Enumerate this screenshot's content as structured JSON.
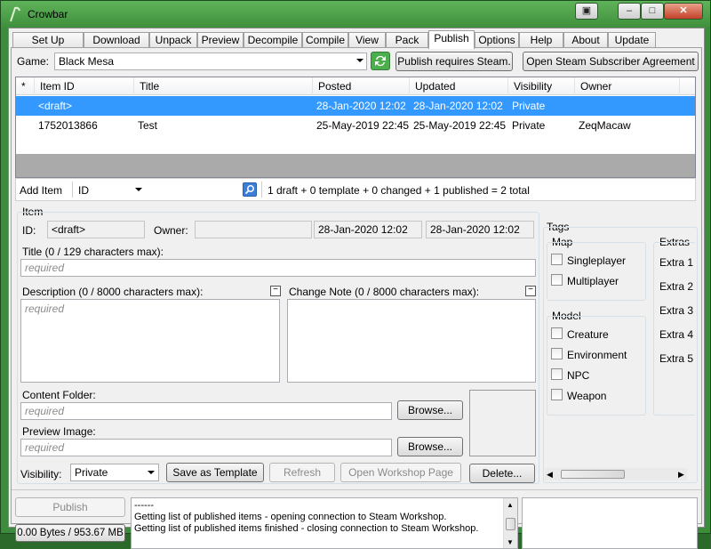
{
  "window": {
    "title": "Crowbar"
  },
  "tabs": [
    {
      "label": "Set Up Games"
    },
    {
      "label": "Download"
    },
    {
      "label": "Unpack"
    },
    {
      "label": "Preview"
    },
    {
      "label": "Decompile"
    },
    {
      "label": "Compile"
    },
    {
      "label": "View"
    },
    {
      "label": "Pack"
    },
    {
      "label": "Publish"
    },
    {
      "label": "Options"
    },
    {
      "label": "Help"
    },
    {
      "label": "About"
    },
    {
      "label": "Update"
    }
  ],
  "game": {
    "label": "Game:",
    "value": "Black Mesa",
    "publish_requires_label": "Publish requires Steam.",
    "open_agreement_label": "Open Steam Subscriber Agreement"
  },
  "list": {
    "headers": [
      "*",
      "Item ID",
      "Title",
      "Posted",
      "Updated",
      "Visibility",
      "Owner"
    ],
    "rows": [
      {
        "star": "",
        "item_id": "<draft>",
        "title": "",
        "posted": "28-Jan-2020 12:02",
        "updated": "28-Jan-2020 12:02",
        "visibility": "Private",
        "owner": ""
      },
      {
        "star": "",
        "item_id": "1752013866",
        "title": "Test",
        "posted": "25-May-2019 22:45",
        "updated": "25-May-2019 22:45",
        "visibility": "Private",
        "owner": "ZeqMacaw"
      }
    ]
  },
  "toolbar": {
    "add_item_label": "Add Item",
    "search_field": "ID",
    "summary": "1 draft + 0 template + 0 changed + 1 published = 2 total"
  },
  "item": {
    "group_label": "Item",
    "id_label": "ID:",
    "id_value": "<draft>",
    "owner_label": "Owner:",
    "owner_value": "",
    "posted_value": "28-Jan-2020 12:02",
    "updated_value": "28-Jan-2020 12:02",
    "title_label": "Title (0 / 129 characters max):",
    "title_placeholder": "required",
    "description_label": "Description (0 / 8000 characters max):",
    "description_placeholder": "required",
    "change_note_label": "Change Note (0 / 8000 characters max):",
    "content_folder_label": "Content Folder:",
    "content_folder_placeholder": "required",
    "preview_image_label": "Preview Image:",
    "preview_image_placeholder": "required",
    "browse_label": "Browse...",
    "visibility_label": "Visibility:",
    "visibility_value": "Private",
    "save_template_label": "Save as Template",
    "refresh_label": "Refresh",
    "open_workshop_label": "Open Workshop Page",
    "delete_label": "Delete..."
  },
  "tags": {
    "label": "Tags",
    "map_label": "Map",
    "map_items": [
      "Singleplayer",
      "Multiplayer"
    ],
    "model_label": "Model",
    "model_items": [
      "Creature",
      "Environment",
      "NPC",
      "Weapon"
    ],
    "extras_label": "Extras",
    "extras_items": [
      "Extra 1",
      "Extra 2",
      "Extra 3",
      "Extra 4",
      "Extra 5"
    ]
  },
  "bottom": {
    "publish_label": "Publish",
    "size_label": "0.00 Bytes / 953.67 MB",
    "log_lines": [
      "------",
      "Getting list of published items - opening connection to Steam Workshop.",
      "Getting list of published items finished - closing connection to Steam Workshop."
    ]
  },
  "colors": {
    "selection": "#3399ff",
    "window_frame": "#3d8b3d"
  }
}
